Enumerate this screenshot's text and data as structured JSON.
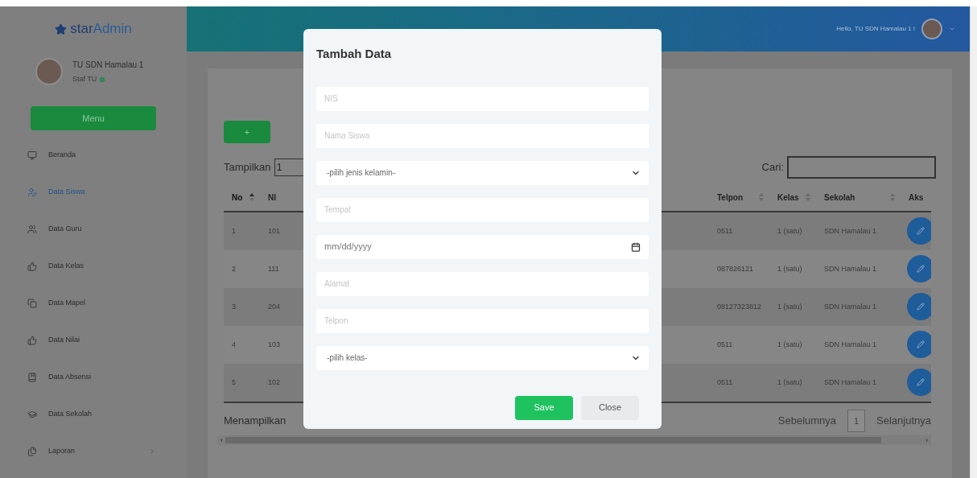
{
  "brand": {
    "prefix": "star",
    "suffix": "Admin"
  },
  "user": {
    "name": "TU SDN Hamalau 1",
    "role": "Staf TU",
    "online": true
  },
  "sidebar": {
    "menu_button": "Menu",
    "items": [
      {
        "label": "Beranda",
        "selected": false,
        "submenu": false
      },
      {
        "label": "Data Siswa",
        "selected": true,
        "submenu": false
      },
      {
        "label": "Data Guru",
        "selected": false,
        "submenu": false
      },
      {
        "label": "Data Kelas",
        "selected": false,
        "submenu": false
      },
      {
        "label": "Data Mapel",
        "selected": false,
        "submenu": false
      },
      {
        "label": "Data Nilai",
        "selected": false,
        "submenu": false
      },
      {
        "label": "Data Absensi",
        "selected": false,
        "submenu": false
      },
      {
        "label": "Data Sekolah",
        "selected": false,
        "submenu": false
      },
      {
        "label": "Laporan",
        "selected": false,
        "submenu": true
      }
    ]
  },
  "header": {
    "greeting": "Hello, TU SDN Hamalau 1 !"
  },
  "content": {
    "add_button": "+",
    "show_label": "Tampilkan",
    "show_value": "1",
    "search_label": "Cari:",
    "table": {
      "columns": [
        {
          "label": "No",
          "sortable": true,
          "sorted": true
        },
        {
          "label": "NI",
          "sortable": false,
          "sorted": false
        },
        {
          "label": "Telpon",
          "sortable": true,
          "sorted": false
        },
        {
          "label": "Kelas",
          "sortable": true,
          "sorted": false
        },
        {
          "label": "Sekolah",
          "sortable": true,
          "sorted": false
        },
        {
          "label": "Aks",
          "sortable": false,
          "sorted": false
        }
      ],
      "rows": [
        {
          "no": "1",
          "nis": "101",
          "telpon": "0511",
          "kelas": "1 (satu)",
          "sekolah": "SDN Hamalau 1"
        },
        {
          "no": "2",
          "nis": "111",
          "telpon": "087826121",
          "kelas": "1 (satu)",
          "sekolah": "SDN Hamalau 1"
        },
        {
          "no": "3",
          "nis": "204",
          "telpon": "08127323812",
          "kelas": "1 (satu)",
          "sekolah": "SDN Hamalau 1"
        },
        {
          "no": "4",
          "nis": "103",
          "telpon": "0511",
          "kelas": "1 (satu)",
          "sekolah": "SDN Hamalau 1"
        },
        {
          "no": "5",
          "nis": "102",
          "telpon": "0511",
          "kelas": "1 (satu)",
          "sekolah": "SDN Hamalau 1"
        }
      ]
    },
    "info": "Menampilkan",
    "pagination": {
      "previous": "Sebelumnya",
      "pages": [
        {
          "label": "1",
          "selected": true
        }
      ],
      "next": "Selanjutnya"
    }
  },
  "modal": {
    "title": "Tambah Data",
    "fields": [
      {
        "kind": "text",
        "placeholder": "NIS"
      },
      {
        "kind": "text",
        "placeholder": "Nama Siswa"
      },
      {
        "kind": "select",
        "value": "-pilih jenis kelamin-"
      },
      {
        "kind": "text",
        "placeholder": "Tempat"
      },
      {
        "kind": "date",
        "value": "mm/dd/yyyy"
      },
      {
        "kind": "text",
        "placeholder": "Alamat"
      },
      {
        "kind": "text",
        "placeholder": "Telpon"
      },
      {
        "kind": "select",
        "value": "-pilih kelas-"
      }
    ],
    "buttons": [
      {
        "label": "Save",
        "kind": "primary"
      },
      {
        "label": "Close",
        "kind": "secondary"
      }
    ]
  }
}
